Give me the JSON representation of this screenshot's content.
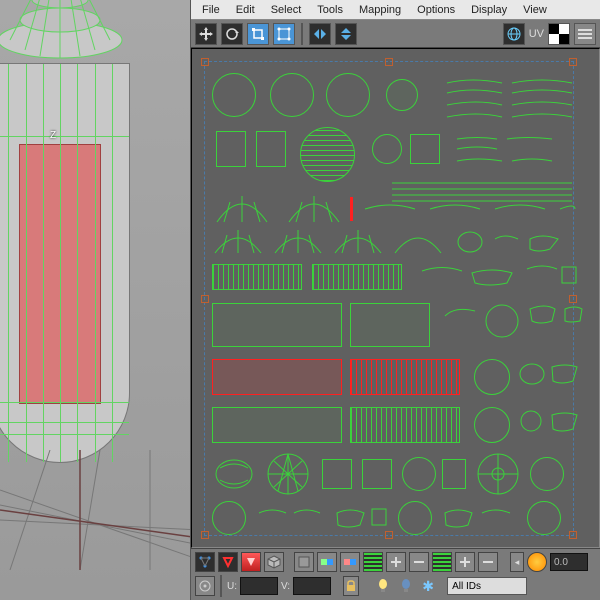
{
  "menubar": {
    "items": [
      "File",
      "Edit",
      "Select",
      "Tools",
      "Mapping",
      "Options",
      "Display",
      "View"
    ]
  },
  "top_toolbar": {
    "uv_label": "UV",
    "checker_tip": "Checker"
  },
  "bottom_toolbar": {
    "u_label": "U:",
    "v_label": "V:",
    "u_value": "",
    "v_value": "",
    "spinner_right": "0.0",
    "filter_dropdown": "All IDs"
  },
  "viewport": {
    "axis_label": "Z"
  },
  "uv": {
    "bounds_handles": true
  }
}
